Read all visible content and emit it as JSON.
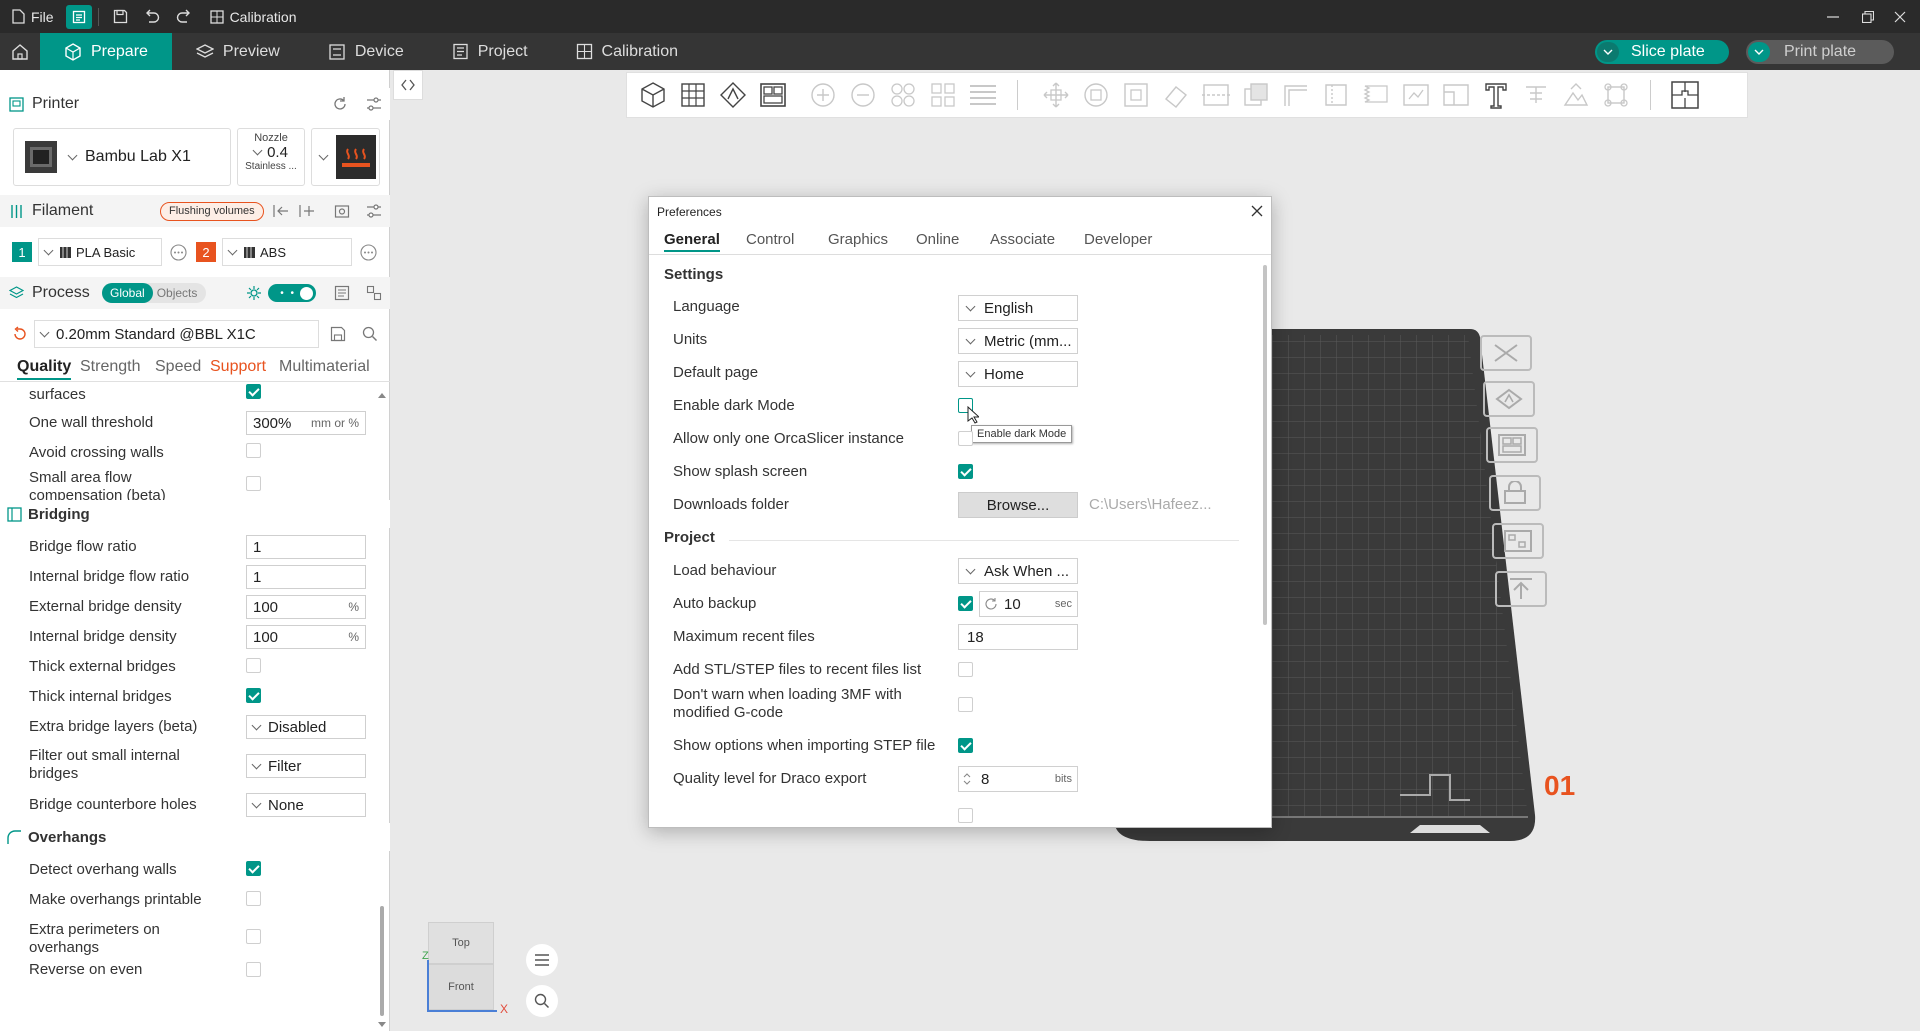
{
  "titlebar": {
    "file_label": "File",
    "calibration_label": "Calibration"
  },
  "nav": {
    "tabs": [
      {
        "label": "Prepare",
        "active": true
      },
      {
        "label": "Preview"
      },
      {
        "label": "Device"
      },
      {
        "label": "Project"
      },
      {
        "label": "Calibration"
      }
    ],
    "slice_plate": "Slice plate",
    "print_plate": "Print plate"
  },
  "printer": {
    "section_label": "Printer",
    "name": "Bambu Lab X1",
    "nozzle_label": "Nozzle",
    "nozzle_value": "0.4",
    "nozzle_material": "Stainless ..."
  },
  "filament": {
    "section_label": "Filament",
    "flushing_label": "Flushing volumes",
    "slots": [
      {
        "index": "1",
        "name": "PLA Basic",
        "color": "#009688"
      },
      {
        "index": "2",
        "name": "ABS",
        "color": "#e8531f"
      }
    ]
  },
  "process": {
    "section_label": "Process",
    "global_label": "Global",
    "objects_label": "Objects",
    "preset": "0.20mm Standard @BBL X1C",
    "tabs": [
      "Quality",
      "Strength",
      "Speed",
      "Support",
      "Multimaterial"
    ]
  },
  "settings": {
    "top_surfaces_label": "surfaces",
    "one_wall_threshold": {
      "label": "One wall threshold",
      "value": "300%",
      "unit": "mm or %"
    },
    "avoid_crossing_walls": "Avoid crossing walls",
    "small_area_flow": "Small area flow compensation (beta)",
    "bridging_header": "Bridging",
    "bridge_flow_ratio": {
      "label": "Bridge flow ratio",
      "value": "1"
    },
    "internal_bridge_flow_ratio": {
      "label": "Internal bridge flow ratio",
      "value": "1"
    },
    "external_bridge_density": {
      "label": "External bridge density",
      "value": "100",
      "unit": "%"
    },
    "internal_bridge_density": {
      "label": "Internal bridge density",
      "value": "100",
      "unit": "%"
    },
    "thick_external_bridges": "Thick external bridges",
    "thick_internal_bridges": "Thick internal bridges",
    "extra_bridge_layers": {
      "label": "Extra bridge layers (beta)",
      "value": "Disabled"
    },
    "filter_small_bridges": {
      "label": "Filter out small internal bridges",
      "value": "Filter"
    },
    "bridge_counterbore": {
      "label": "Bridge counterbore holes",
      "value": "None"
    },
    "overhangs_header": "Overhangs",
    "detect_overhang_walls": "Detect overhang walls",
    "make_overhangs_printable": "Make overhangs printable",
    "extra_perimeters_overhangs": "Extra perimeters on overhangs",
    "reverse_on_even": "Reverse on even"
  },
  "viewcube": {
    "top": "Top",
    "front": "Front",
    "z": "Z",
    "x": "X"
  },
  "plate": {
    "number": "01",
    "color": "#e8531f"
  },
  "preferences": {
    "title": "Preferences",
    "tabs": [
      "General",
      "Control",
      "Graphics",
      "Online",
      "Associate",
      "Developer"
    ],
    "settings_header": "Settings",
    "language": {
      "label": "Language",
      "value": "English"
    },
    "units": {
      "label": "Units",
      "value": "Metric (mm..."
    },
    "default_page": {
      "label": "Default page",
      "value": "Home"
    },
    "dark_mode": {
      "label": "Enable dark Mode",
      "tooltip": "Enable dark Mode"
    },
    "one_instance": {
      "label": "Allow only one OrcaSlicer instance"
    },
    "splash": {
      "label": "Show splash screen"
    },
    "downloads": {
      "label": "Downloads folder",
      "button": "Browse...",
      "path": "C:\\Users\\Hafeez..."
    },
    "project_header": "Project",
    "load_behaviour": {
      "label": "Load behaviour",
      "value": "Ask When ..."
    },
    "auto_backup": {
      "label": "Auto backup",
      "value": "10",
      "unit": "sec"
    },
    "max_recent": {
      "label": "Maximum recent files",
      "value": "18"
    },
    "add_stl": {
      "label": "Add STL/STEP files to recent files list"
    },
    "dont_warn_3mf": {
      "label": "Don't warn when loading 3MF with modified G-code"
    },
    "step_options": {
      "label": "Show options when importing STEP file"
    },
    "draco": {
      "label": "Quality level for Draco export",
      "value": "8",
      "unit": "bits"
    }
  },
  "colors": {
    "accent": "#009688",
    "orange": "#e8531f"
  }
}
